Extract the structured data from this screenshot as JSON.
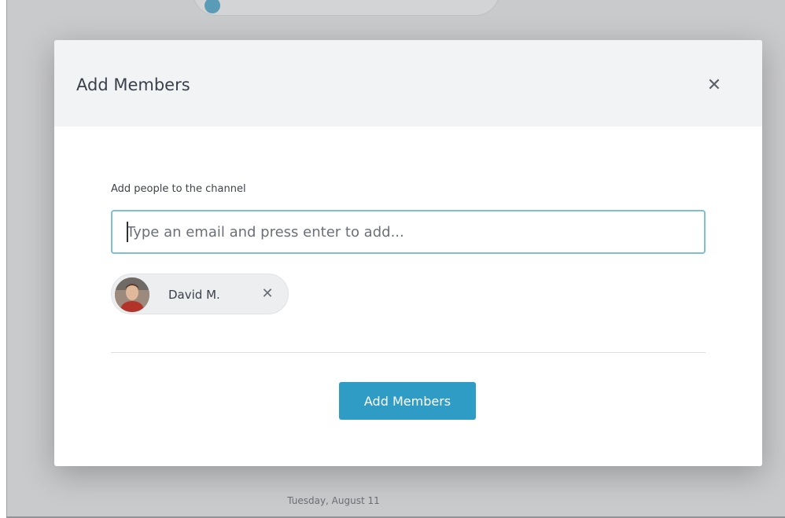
{
  "background": {
    "date_label": "Tuesday, August 11"
  },
  "modal": {
    "title": "Add Members",
    "close_icon": "close-icon",
    "field_label": "Add people to the channel",
    "input": {
      "value": "",
      "placeholder": "Type an email and press enter to add..."
    },
    "chips": [
      {
        "name": "David M.",
        "avatar": "avatar",
        "remove_icon": "close-icon"
      }
    ],
    "submit_label": "Add Members"
  },
  "colors": {
    "accent": "#2f9cc6",
    "input_border": "#7fbfd3",
    "header_bg": "#f2f3f5",
    "backdrop": "#c9cacc"
  }
}
